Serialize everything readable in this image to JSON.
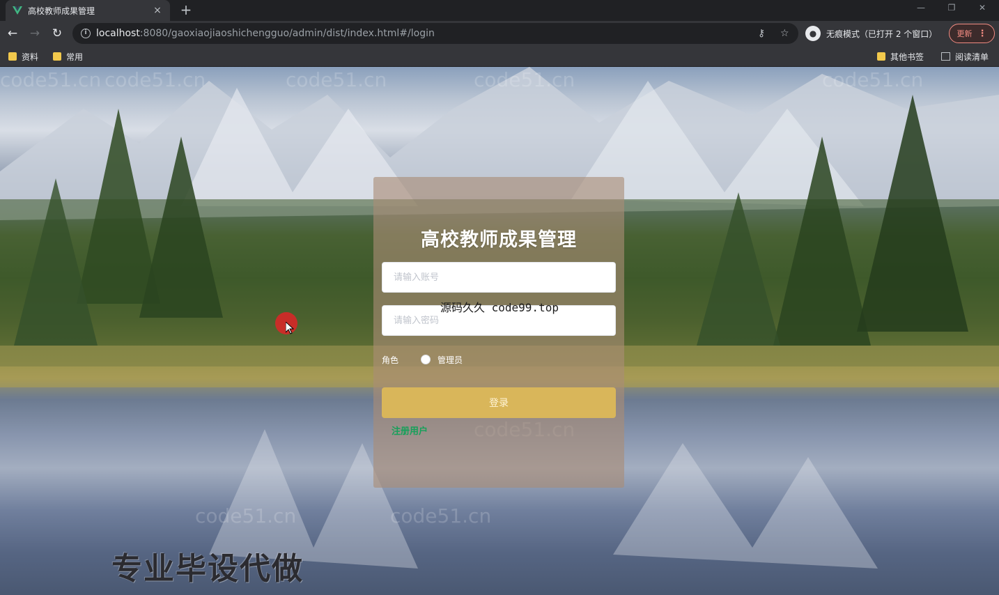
{
  "browser": {
    "tab_title": "高校教师成果管理",
    "tab_close": "×",
    "new_tab": "+",
    "url_host": "localhost",
    "url_rest": ":8080/gaoxiaojiaoshichengguo/admin/dist/index.html#/login",
    "incognito_text": "无痕模式（已打开 2 个窗口）",
    "update_label": "更新",
    "bookmarks": [
      "资料",
      "常用"
    ],
    "bookmarks_right": [
      "其他书签",
      "阅读清单"
    ]
  },
  "login": {
    "title": "高校教师成果管理",
    "username_placeholder": "请输入账号",
    "password_placeholder": "请输入密码",
    "role_label": "角色",
    "role_option": "管理员",
    "login_button": "登录",
    "register_link": "注册用户"
  },
  "overlays": {
    "center_watermark": "源码久久 code99.top",
    "site_watermark": "code51.cn",
    "promo_text": "专业毕设代做"
  },
  "colors": {
    "accent_button": "#d9b65a",
    "register_link": "#16a05a",
    "card_bg": "rgba(170,140,118,0.62)"
  }
}
